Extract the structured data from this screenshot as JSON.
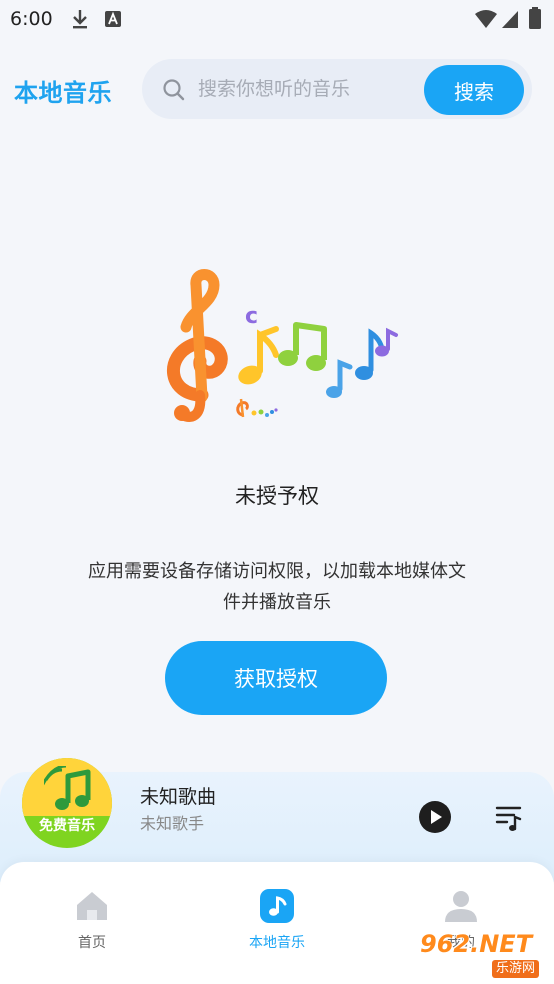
{
  "status_bar": {
    "time": "6:00"
  },
  "header": {
    "title": "本地音乐",
    "search_placeholder": "搜索你想听的音乐",
    "search_button": "搜索"
  },
  "empty_state": {
    "title": "未授予权",
    "description": "应用需要设备存储访问权限，以加载本地媒体文件并播放音乐",
    "button": "获取授权"
  },
  "player": {
    "album_label": "免费音乐",
    "song_title": "未知歌曲",
    "artist": "未知歌手"
  },
  "bottom_nav": {
    "items": [
      {
        "label": "首页",
        "icon": "home-icon",
        "active": false
      },
      {
        "label": "本地音乐",
        "icon": "music-note-icon",
        "active": true
      },
      {
        "label": "我的",
        "icon": "user-icon",
        "active": false
      }
    ]
  },
  "watermark": {
    "main": "962.NET",
    "sub": "乐游网"
  },
  "colors": {
    "accent": "#1aa5f5",
    "background": "#f4f6fa"
  }
}
